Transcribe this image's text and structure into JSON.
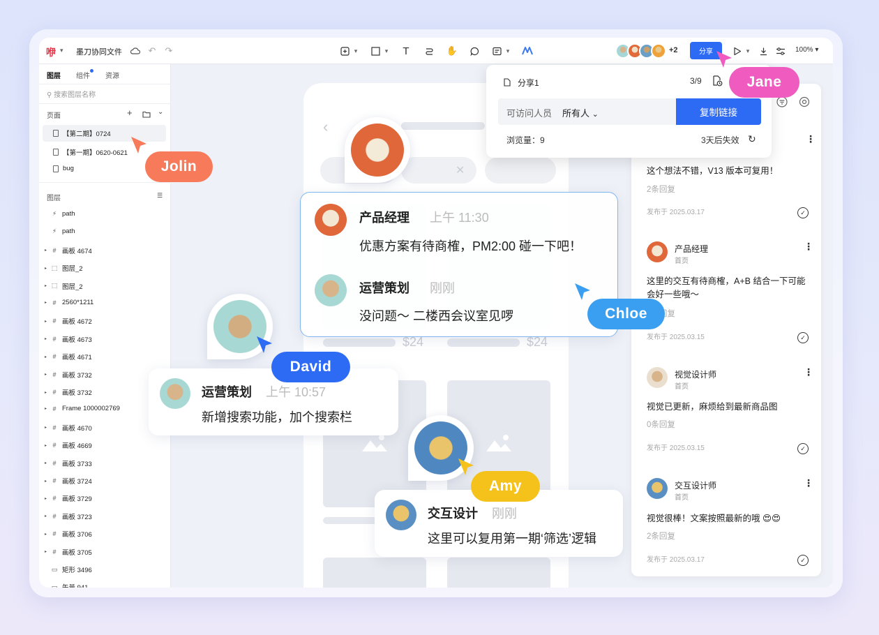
{
  "colors": {
    "accent": "#2e6bf5",
    "jolin": "#f77a5a",
    "jane": "#f05bc0",
    "chloe": "#3a9ff0",
    "david": "#2e6bf5",
    "amy": "#f4c21a"
  },
  "toolbar": {
    "logo": "咿",
    "doc_title": "墨刀协同文件",
    "avatars_more": "+2",
    "share_label": "分享",
    "zoom": "100%",
    "icons": [
      "cloud-icon",
      "undo-icon",
      "redo-icon",
      "frame-icon",
      "rect-icon",
      "text-icon",
      "path-icon",
      "hand-icon",
      "comment-icon",
      "note-icon",
      "ai-icon",
      "play-icon",
      "download-icon",
      "settings-icon"
    ]
  },
  "left": {
    "tabs": [
      "图层",
      "组件",
      "资源"
    ],
    "search_placeholder": "搜索图层名称",
    "pages_title": "页面",
    "pages": [
      "【第二期】0724",
      "【第一期】0620-0621",
      "bug"
    ],
    "layers_title": "图层",
    "layers": [
      {
        "icon": "path",
        "label": "path",
        "expand": false
      },
      {
        "icon": "path",
        "label": "path",
        "expand": false
      },
      {
        "icon": "board",
        "label": "画板 4674",
        "expand": true
      },
      {
        "icon": "group",
        "label": "图层_2",
        "expand": true
      },
      {
        "icon": "group",
        "label": "图层_2",
        "expand": true
      },
      {
        "icon": "board",
        "label": "2560*1211",
        "expand": true
      },
      {
        "icon": "board",
        "label": "画板 4672",
        "expand": true
      },
      {
        "icon": "board",
        "label": "画板 4673",
        "expand": true
      },
      {
        "icon": "board",
        "label": "画板 4671",
        "expand": true
      },
      {
        "icon": "board",
        "label": "画板 3732",
        "expand": true
      },
      {
        "icon": "board",
        "label": "画板 3732",
        "expand": true
      },
      {
        "icon": "board",
        "label": "Frame 1000002769",
        "expand": true
      },
      {
        "icon": "board",
        "label": "画板 4670",
        "expand": true
      },
      {
        "icon": "board",
        "label": "画板 4669",
        "expand": true
      },
      {
        "icon": "board",
        "label": "画板 3733",
        "expand": true
      },
      {
        "icon": "board",
        "label": "画板 3724",
        "expand": true
      },
      {
        "icon": "board",
        "label": "画板 3729",
        "expand": true
      },
      {
        "icon": "board",
        "label": "画板 3723",
        "expand": true
      },
      {
        "icon": "board",
        "label": "画板 3706",
        "expand": true
      },
      {
        "icon": "board",
        "label": "画板 3705",
        "expand": true
      },
      {
        "icon": "rect",
        "label": "矩形 3496",
        "expand": false
      },
      {
        "icon": "rect",
        "label": "矢量 941",
        "expand": false
      }
    ]
  },
  "canvas": {
    "price1": "$24",
    "price2": "$24"
  },
  "share_popup": {
    "title": "分享1",
    "count": "3/9",
    "access_label": "可访问人员",
    "access_value": "所有人",
    "copy_label": "复制链接",
    "views": "浏览量：9",
    "expire": "3天后失效"
  },
  "comments": [
    {
      "name": "",
      "sub": "",
      "text": "这个想法不错，V13 版本可复用！",
      "reply": "2条回复",
      "date": "发布于 2025.03.17"
    },
    {
      "name": "产品经理",
      "sub": "首页",
      "text": "这里的交互有待商榷，A+B 结合一下可能会好一些哦～",
      "reply": "2条回复",
      "date": "发布于 2025.03.15"
    },
    {
      "name": "视觉设计师",
      "sub": "首页",
      "text": "视觉已更新，麻烦给到最新商品图",
      "reply": "0条回复",
      "date": "发布于 2025.03.15"
    },
    {
      "name": "交互设计师",
      "sub": "首页",
      "text": "视觉很棒！文案按照最新的哦 😍😍",
      "reply": "2条回复",
      "date": "发布于 2025.03.17"
    }
  ],
  "float": {
    "card1": {
      "a_name": "产品经理",
      "a_time": "上午 11:30",
      "a_text": "优惠方案有待商榷，PM2:00 碰一下吧！",
      "b_name": "运营策划",
      "b_time": "刚刚",
      "b_text": "没问题～ 二楼西会议室见啰"
    },
    "card2": {
      "name": "运营策划",
      "time": "上午 10:57",
      "text": "新增搜索功能，加个搜索栏"
    },
    "card3": {
      "name": "交互设计",
      "time": "刚刚",
      "text": "这里可以复用第一期‘筛选’逻辑"
    }
  },
  "cursors": {
    "jolin": "Jolin",
    "jane": "Jane",
    "chloe": "Chloe",
    "david": "David",
    "amy": "Amy"
  }
}
